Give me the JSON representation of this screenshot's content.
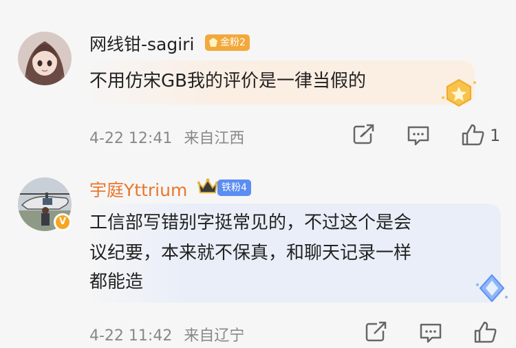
{
  "comments": [
    {
      "username": "网线钳-sagiri",
      "fan_badge": "金粉2",
      "text_lines": [
        "不用仿宋GB我的评价是一律当假的"
      ],
      "time": "4-22 12:41",
      "location": "来自江西",
      "like_count": "1",
      "username_color": "#333333",
      "bubble_color": "#fbeee3",
      "badge_color": "#f2a93b"
    },
    {
      "username": "宇庭Yttrium",
      "fan_badge": "铁粉4",
      "text_lines": [
        "工信部写错别字挺常见的，不过这个是会",
        "议纪要，本来就不保真，和聊天记录一样",
        "都能造"
      ],
      "time": "4-22 11:42",
      "location": "来自辽宁",
      "like_count": "",
      "username_color": "#e9762b",
      "bubble_color": "#e9eef8",
      "badge_color": "#5b8df2"
    }
  ],
  "icons": [
    "share-icon",
    "comment-icon",
    "like-icon",
    "verified-badge-icon",
    "crown-icon"
  ]
}
